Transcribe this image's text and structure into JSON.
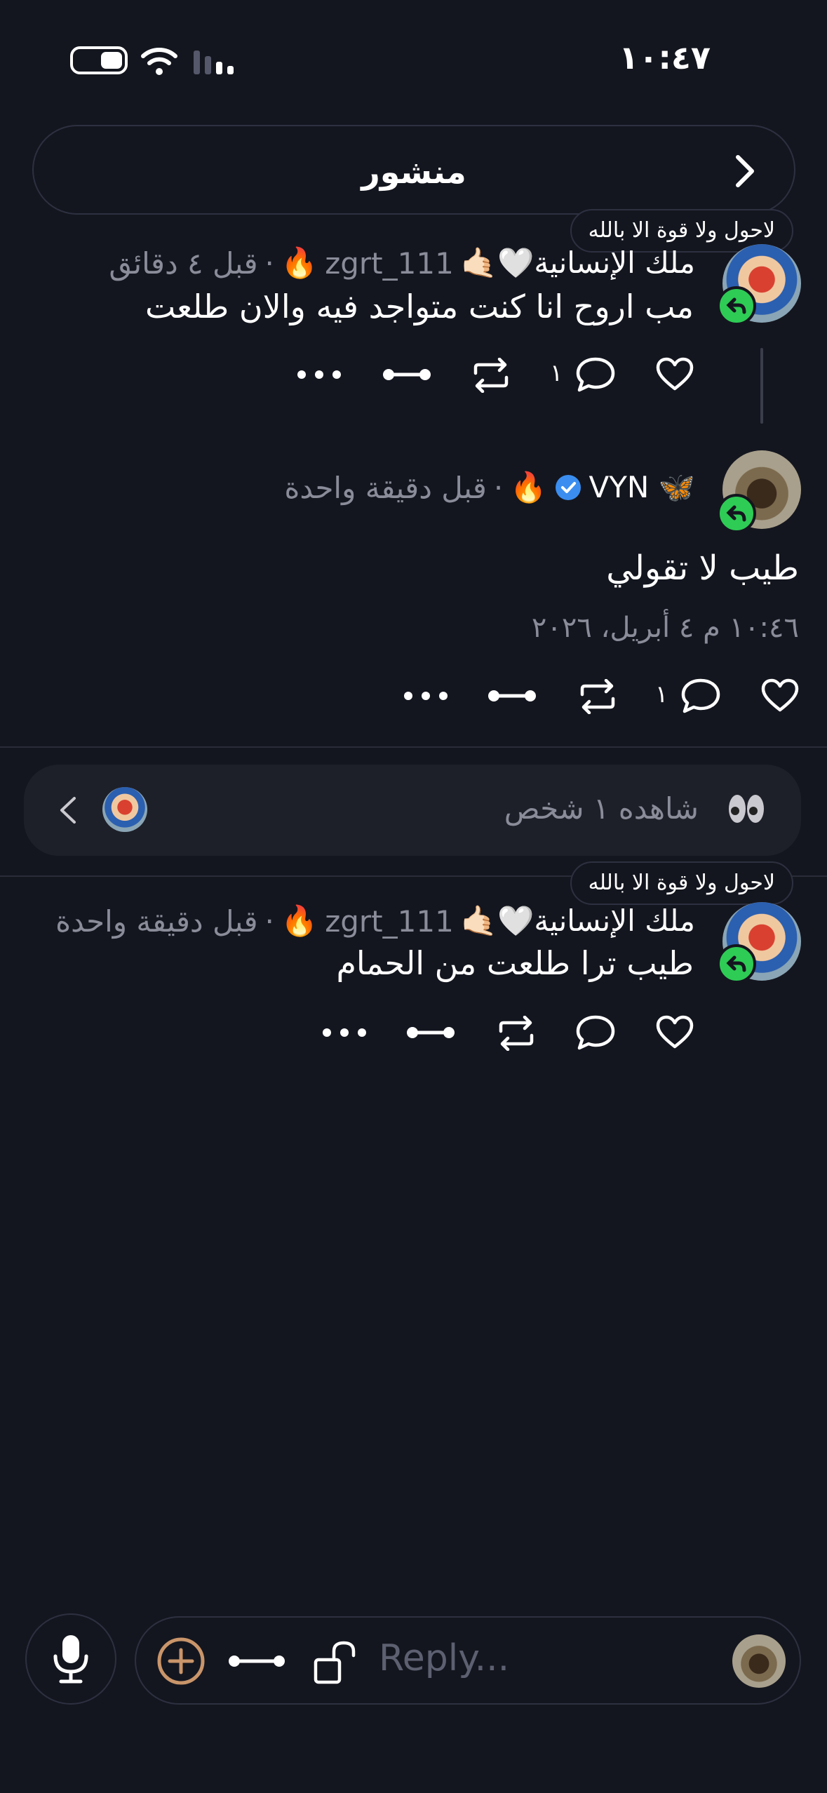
{
  "status_bar": {
    "time": "١٠:٤٧"
  },
  "header": {
    "title": "منشور"
  },
  "posts": [
    {
      "badge": "لاحول ولا قوة الا بالله",
      "name": "ملك الإنسانية🤍🤙🏻",
      "handle": "zgrt_111",
      "time": "قبل ٤ دقائق",
      "text": "مب اروح انا كنت متواجد فيه والان طلعت",
      "reply_count": "١"
    },
    {
      "name": "🦋 VYN",
      "time": "قبل دقيقة واحدة",
      "text": "طيب لا تقولي",
      "timestamp": "١٠:٤٦ م ٤ أبريل، ٢٠٢٦",
      "reply_count": "١"
    },
    {
      "badge": "لاحول ولا قوة الا بالله",
      "name": "ملك الإنسانية🤍🤙🏻",
      "handle": "zgrt_111",
      "time": "قبل دقيقة واحدة",
      "text": "طيب ترا طلعت من الحمام"
    }
  ],
  "viewers": {
    "label": "شاهده ١ شخص"
  },
  "reply_bar": {
    "placeholder": "Reply..."
  },
  "colors": {
    "background": "#14161f",
    "muted": "#8a8d99",
    "reply_badge": "#2ecc55",
    "verified": "#3b8ef0",
    "add_icon": "#c9956a"
  }
}
